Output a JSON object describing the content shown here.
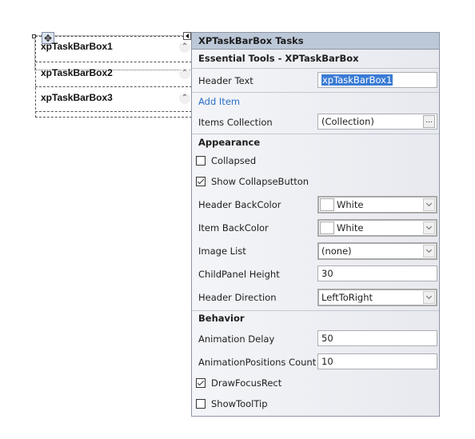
{
  "designer": {
    "items": [
      {
        "label": "xpTaskBarBox1",
        "collapse_icon": "double-chevron-up"
      },
      {
        "label": "xpTaskBarBox2",
        "collapse_icon": "double-chevron-up"
      },
      {
        "label": "xpTaskBarBox3",
        "collapse_icon": "double-chevron-up"
      }
    ],
    "move_glyph": "✥",
    "collapse_glyph": "⌃"
  },
  "panel": {
    "title": "XPTaskBarBox Tasks",
    "subtitle": "Essential Tools - XPTaskBarBox",
    "header_text": {
      "label": "Header Text",
      "value": "xpTaskBarBox1"
    },
    "add_item": "Add Item",
    "items_collection": {
      "label": "Items Collection",
      "value": "(Collection)",
      "button": "..."
    },
    "appearance": {
      "title": "Appearance",
      "collapsed": {
        "label": "Collapsed",
        "checked": false
      },
      "show_collapse_button": {
        "label": "Show CollapseButton",
        "checked": true
      },
      "header_backcolor": {
        "label": "Header BackColor",
        "value": "White",
        "swatch": "#ffffff"
      },
      "item_backcolor": {
        "label": "Item BackColor",
        "value": "White",
        "swatch": "#ffffff"
      },
      "image_list": {
        "label": "Image List",
        "value": "(none)"
      },
      "childpanel_height": {
        "label": "ChildPanel Height",
        "value": "30"
      },
      "header_direction": {
        "label": "Header Direction",
        "value": "LeftToRight"
      }
    },
    "behavior": {
      "title": "Behavior",
      "animation_delay": {
        "label": "Animation Delay",
        "value": "50"
      },
      "animation_positions_count": {
        "label": "AnimationPositions Count",
        "value": "10"
      },
      "draw_focus_rect": {
        "label": "DrawFocusRect",
        "checked": true
      },
      "show_tooltip": {
        "label": "ShowToolTip",
        "checked": false
      }
    }
  },
  "colors": {
    "title_bar": "#bcc8d8",
    "link": "#2a6fc6",
    "selection": "#3a7bd5"
  }
}
